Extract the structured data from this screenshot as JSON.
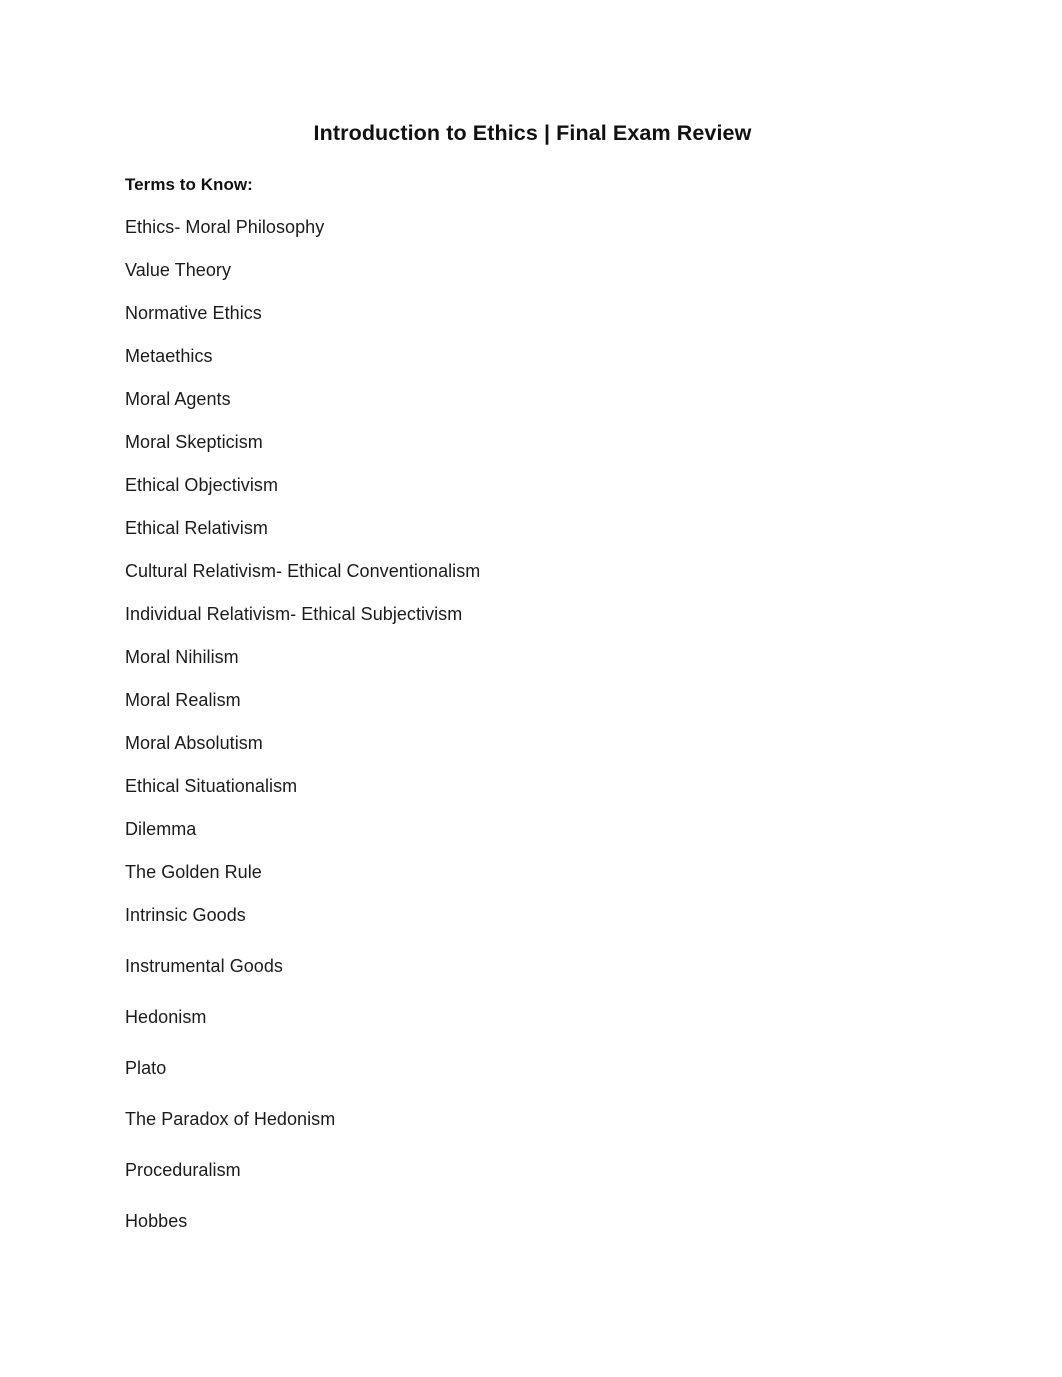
{
  "document": {
    "title": "Introduction to Ethics | Final Exam Review",
    "section_heading": "Terms to Know:",
    "terms": [
      {
        "label": "Ethics- Moral Philosophy",
        "spacing": "tight"
      },
      {
        "label": "Value Theory",
        "spacing": "tight"
      },
      {
        "label": "Normative Ethics",
        "spacing": "tight"
      },
      {
        "label": "Metaethics",
        "spacing": "tight"
      },
      {
        "label": "Moral Agents",
        "spacing": "tight"
      },
      {
        "label": "Moral Skepticism",
        "spacing": "tight"
      },
      {
        "label": "Ethical Objectivism",
        "spacing": "tight"
      },
      {
        "label": "Ethical Relativism",
        "spacing": "tight"
      },
      {
        "label": "Cultural Relativism- Ethical Conventionalism",
        "spacing": "tight"
      },
      {
        "label": "Individual Relativism- Ethical Subjectivism",
        "spacing": "tight"
      },
      {
        "label": "Moral Nihilism",
        "spacing": "tight"
      },
      {
        "label": "Moral Realism",
        "spacing": "tight"
      },
      {
        "label": "Moral Absolutism",
        "spacing": "tight"
      },
      {
        "label": "Ethical Situationalism",
        "spacing": "tight"
      },
      {
        "label": "Dilemma",
        "spacing": "tight"
      },
      {
        "label": "The Golden Rule",
        "spacing": "tight"
      },
      {
        "label": "Intrinsic Goods",
        "spacing": "tight"
      },
      {
        "label": "Instrumental Goods",
        "spacing": "loose"
      },
      {
        "label": "Hedonism",
        "spacing": "loose"
      },
      {
        "label": "Plato",
        "spacing": "loose"
      },
      {
        "label": "The Paradox of Hedonism",
        "spacing": "loose"
      },
      {
        "label": "Proceduralism",
        "spacing": "loose"
      },
      {
        "label": "Hobbes",
        "spacing": "loose"
      }
    ]
  }
}
